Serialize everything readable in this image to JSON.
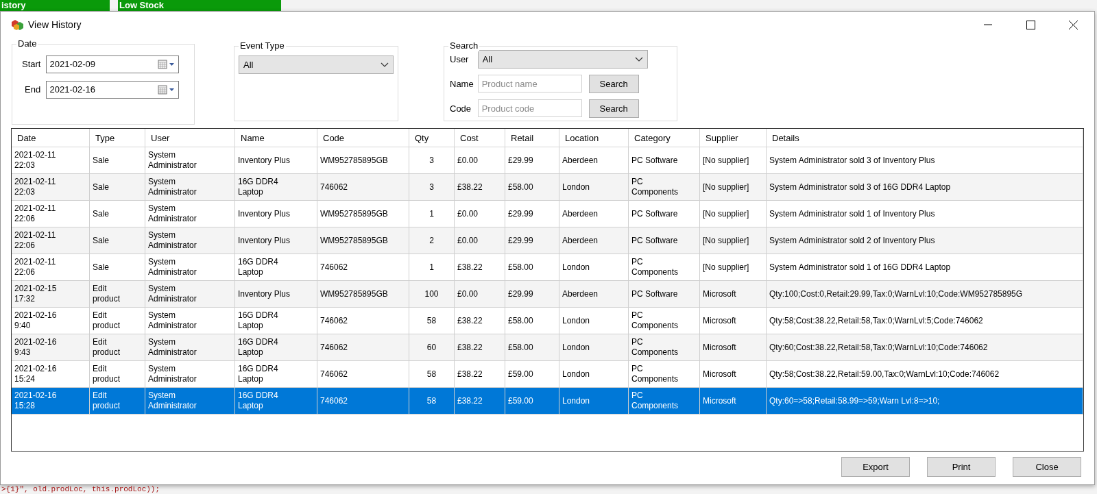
{
  "background": {
    "tabs": [
      "istory",
      "Low Stock"
    ],
    "code_line": ">{1}\", old.prodLoc, this.prodLoc));"
  },
  "window": {
    "title": "View History"
  },
  "date_group": {
    "title": "Date",
    "start_label": "Start",
    "start_value": "2021-02-09",
    "end_label": "End",
    "end_value": "2021-02-16"
  },
  "event_group": {
    "title": "Event Type",
    "value": "All"
  },
  "search_group": {
    "title": "Search",
    "user_label": "User",
    "user_value": "All",
    "name_label": "Name",
    "name_placeholder": "Product name",
    "code_label": "Code",
    "code_placeholder": "Product code",
    "search_buttons": [
      "Search",
      "Search"
    ]
  },
  "table": {
    "columns": [
      "Date",
      "Type",
      "User",
      "Name",
      "Code",
      "Qty",
      "Cost",
      "Retail",
      "Location",
      "Category",
      "Supplier",
      "Details"
    ],
    "rows": [
      {
        "selected": false,
        "cells": [
          "2021-02-11\n22:03",
          "Sale",
          "System\nAdministrator",
          "Inventory Plus",
          "WM952785895GB",
          "3",
          "£0.00",
          "£29.99",
          "Aberdeen",
          "PC Software",
          "[No supplier]",
          "System Administrator sold 3 of Inventory Plus"
        ]
      },
      {
        "selected": false,
        "cells": [
          "2021-02-11\n22:03",
          "Sale",
          "System\nAdministrator",
          "16G DDR4\nLaptop",
          "746062",
          "3",
          "£38.22",
          "£58.00",
          "London",
          "PC\nComponents",
          "[No supplier]",
          "System Administrator sold 3 of 16G DDR4 Laptop"
        ]
      },
      {
        "selected": false,
        "cells": [
          "2021-02-11\n22:06",
          "Sale",
          "System\nAdministrator",
          "Inventory Plus",
          "WM952785895GB",
          "1",
          "£0.00",
          "£29.99",
          "Aberdeen",
          "PC Software",
          "[No supplier]",
          "System Administrator sold 1 of Inventory Plus"
        ]
      },
      {
        "selected": false,
        "cells": [
          "2021-02-11\n22:06",
          "Sale",
          "System\nAdministrator",
          "Inventory Plus",
          "WM952785895GB",
          "2",
          "£0.00",
          "£29.99",
          "Aberdeen",
          "PC Software",
          "[No supplier]",
          "System Administrator sold 2 of Inventory Plus"
        ]
      },
      {
        "selected": false,
        "cells": [
          "2021-02-11\n22:06",
          "Sale",
          "System\nAdministrator",
          "16G DDR4\nLaptop",
          "746062",
          "1",
          "£38.22",
          "£58.00",
          "London",
          "PC\nComponents",
          "[No supplier]",
          "System Administrator sold 1 of 16G DDR4 Laptop"
        ]
      },
      {
        "selected": false,
        "cells": [
          "2021-02-15\n17:32",
          "Edit\nproduct",
          "System\nAdministrator",
          "Inventory Plus",
          "WM952785895GB",
          "100",
          "£0.00",
          "£29.99",
          "Aberdeen",
          "PC Software",
          "Microsoft",
          "Qty:100;Cost:0,Retail:29.99,Tax:0;WarnLvl:10;Code:WM952785895G"
        ]
      },
      {
        "selected": false,
        "cells": [
          "2021-02-16\n9:40",
          "Edit\nproduct",
          "System\nAdministrator",
          "16G DDR4\nLaptop",
          "746062",
          "58",
          "£38.22",
          "£58.00",
          "London",
          "PC\nComponents",
          "Microsoft",
          "Qty:58;Cost:38.22,Retail:58,Tax:0;WarnLvl:5;Code:746062"
        ]
      },
      {
        "selected": false,
        "cells": [
          "2021-02-16\n9:43",
          "Edit\nproduct",
          "System\nAdministrator",
          "16G DDR4\nLaptop",
          "746062",
          "60",
          "£38.22",
          "£58.00",
          "London",
          "PC\nComponents",
          "Microsoft",
          "Qty:60;Cost:38.22,Retail:58,Tax:0;WarnLvl:10;Code:746062"
        ]
      },
      {
        "selected": false,
        "cells": [
          "2021-02-16\n15:24",
          "Edit\nproduct",
          "System\nAdministrator",
          "16G DDR4\nLaptop",
          "746062",
          "58",
          "£38.22",
          "£59.00",
          "London",
          "PC\nComponents",
          "Microsoft",
          "Qty:58;Cost:38.22,Retail:59.00,Tax:0;WarnLvl:10;Code:746062"
        ]
      },
      {
        "selected": true,
        "cells": [
          "2021-02-16\n15:28",
          "Edit\nproduct",
          "System\nAdministrator",
          "16G DDR4\nLaptop",
          "746062",
          "58",
          "£38.22",
          "£59.00",
          "London",
          "PC\nComponents",
          "Microsoft",
          "Qty:60=>58;Retail:58.99=>59;Warn Lvl:8=>10;"
        ]
      }
    ]
  },
  "buttons": [
    "Export",
    "Print",
    "Close"
  ]
}
